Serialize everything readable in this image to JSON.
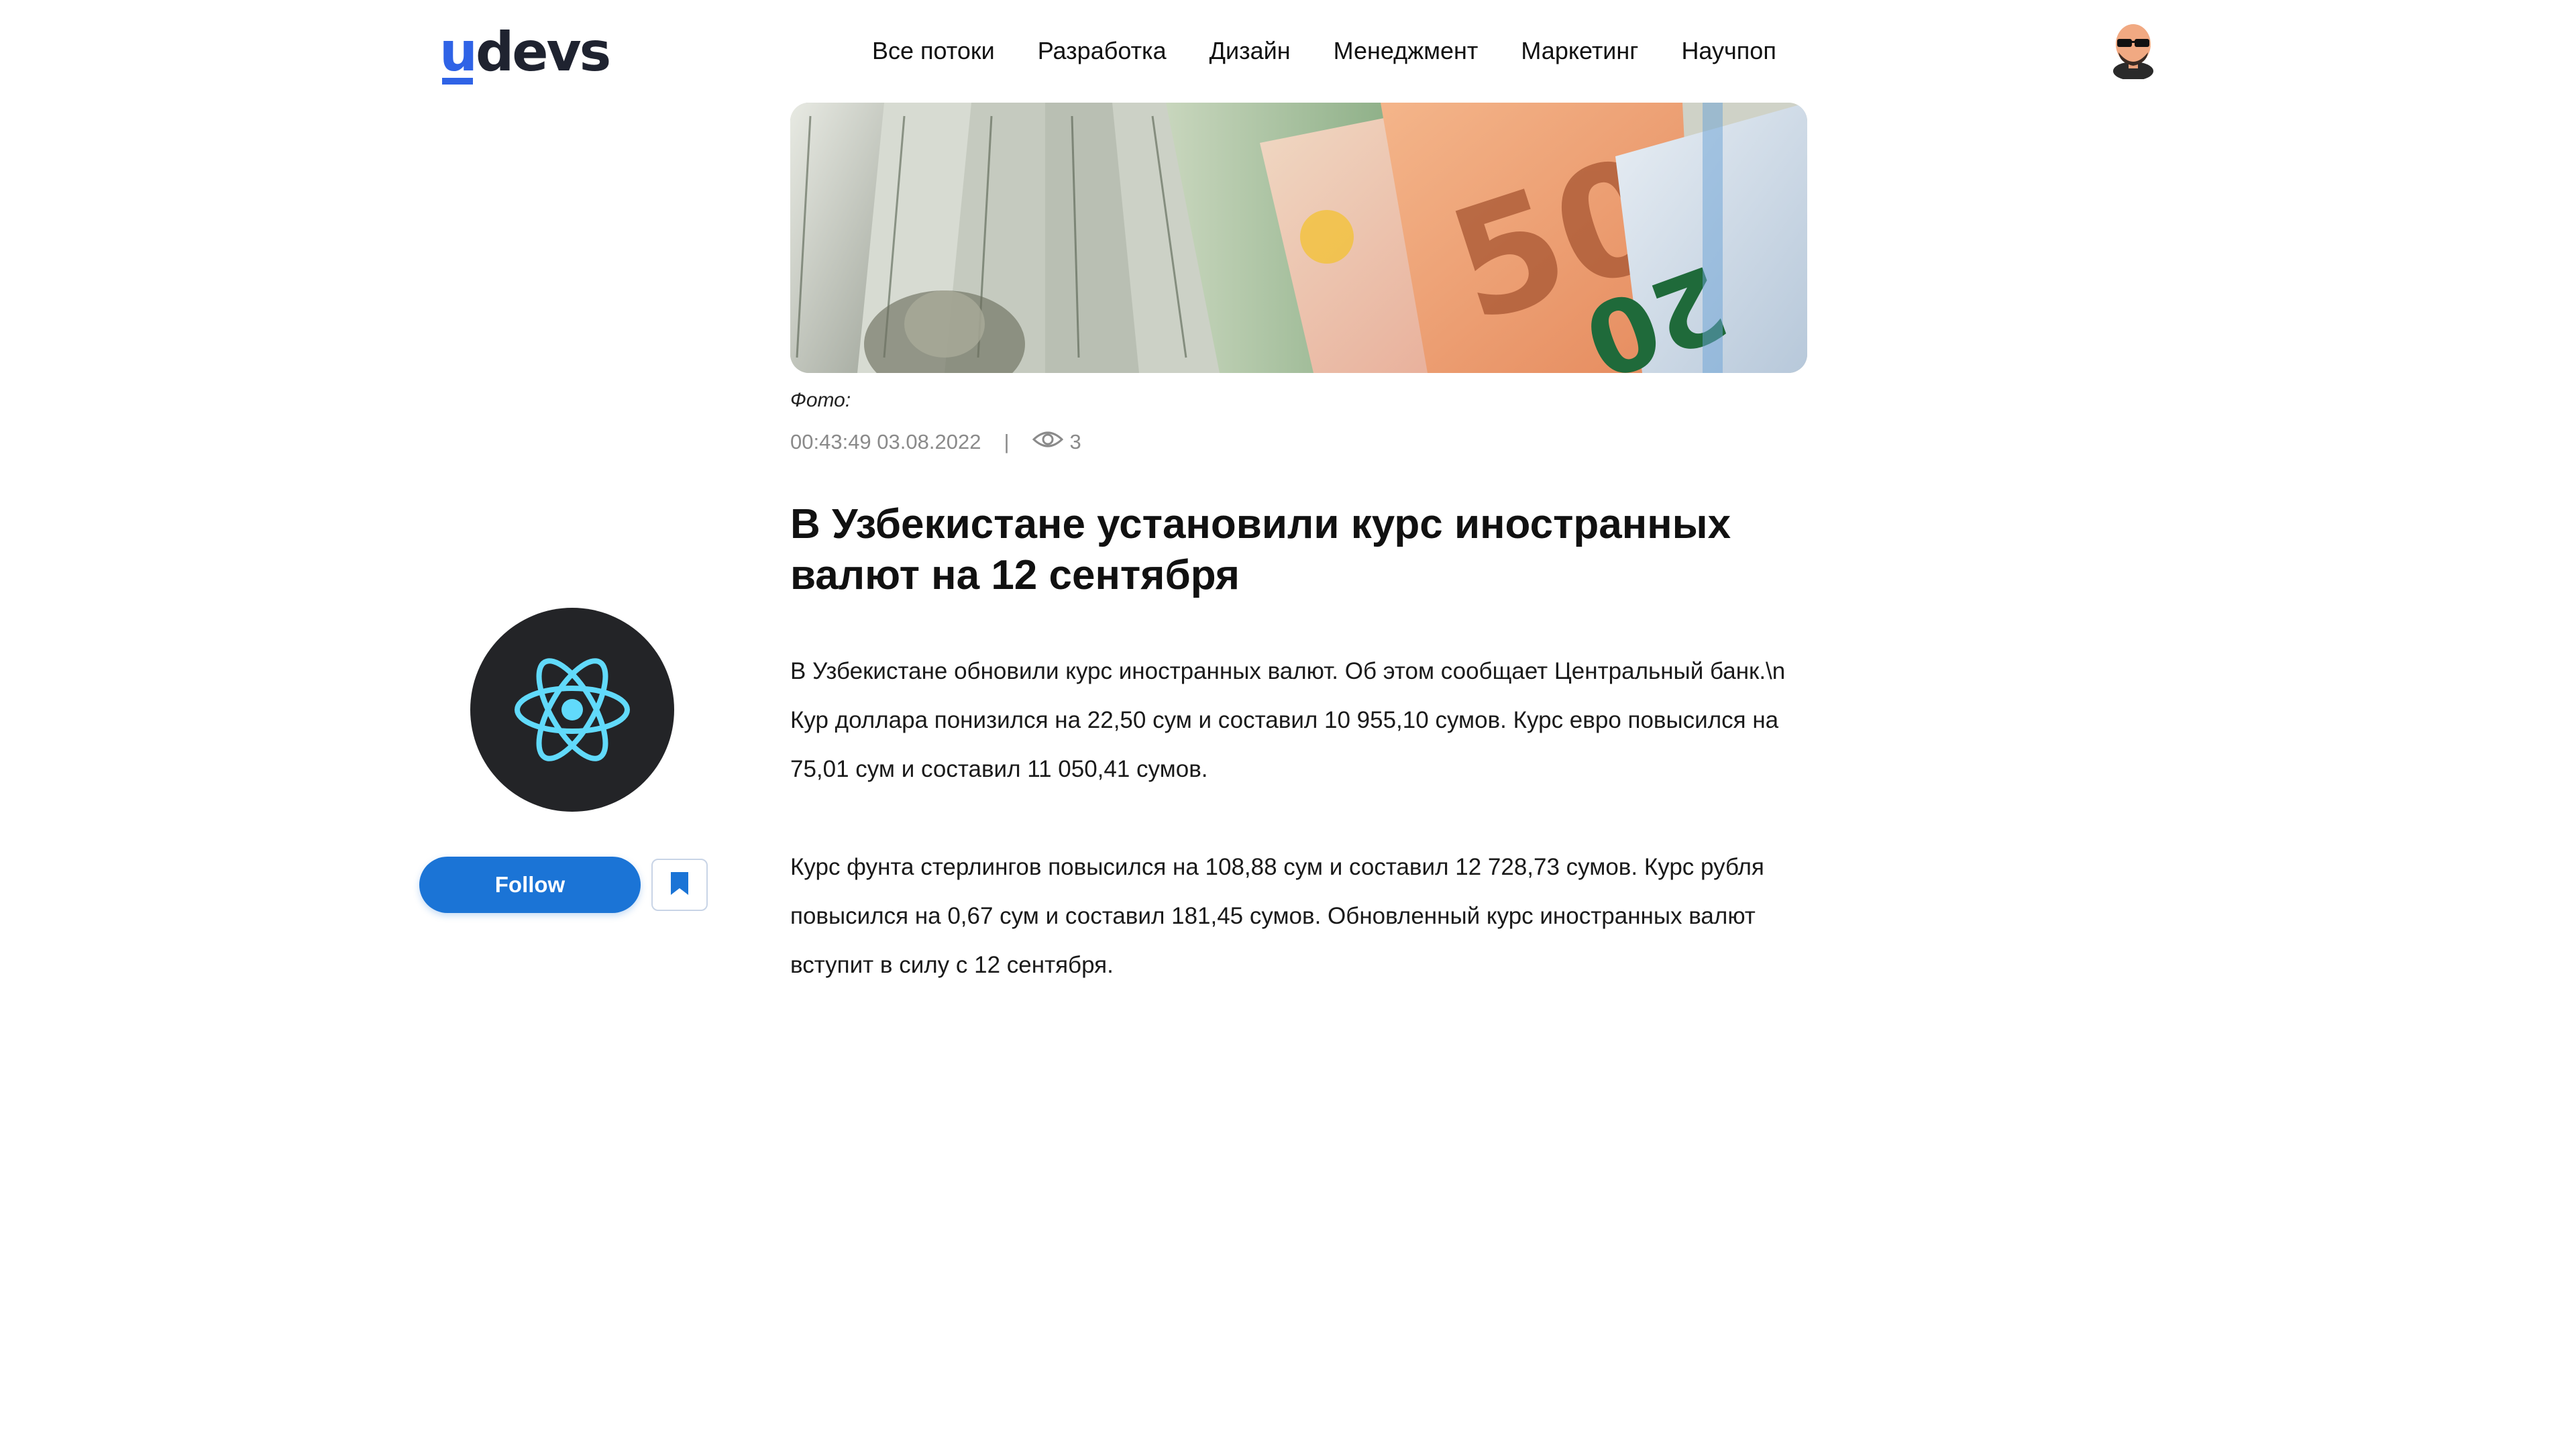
{
  "header": {
    "logo_first": "u",
    "logo_rest": "devs",
    "nav": [
      {
        "label": "Все потоки"
      },
      {
        "label": "Разработка"
      },
      {
        "label": "Дизайн"
      },
      {
        "label": "Менеджмент"
      },
      {
        "label": "Маркетинг"
      },
      {
        "label": "Научпоп"
      }
    ],
    "avatar_icon": "user-avatar-icon"
  },
  "article": {
    "caption": "Фото:",
    "timestamp": "00:43:49 03.08.2022",
    "separator": "|",
    "views": "3",
    "title": "В Узбекистане установили курс иностранных валют на 12 сентября",
    "paragraphs": [
      "В Узбекистане обновили курс иностранных валют. Об этом сообщает Центральный банк.\\n",
      "Кур доллара понизился на 22,50 сум и составил 10 955,10 сумов. Курс евро повысился на 75,01 сум и составил 11 050,41 сумов.",
      "Курс фунта стерлингов повысился на 108,88 сум и составил 12 728,73 сумов. Курс рубля повысился на 0,67 сум и составил 181,45 сумов. Обновленный курс иностранных валют вступит в силу с 12 сентября."
    ]
  },
  "sidebar": {
    "author_icon": "react-atom-icon",
    "follow_label": "Follow",
    "bookmark_icon": "bookmark-icon"
  },
  "colors": {
    "accent": "#1b74d6",
    "logo_blue": "#2f63e6",
    "author_bg": "#232427",
    "react_cyan": "#61dafb"
  }
}
